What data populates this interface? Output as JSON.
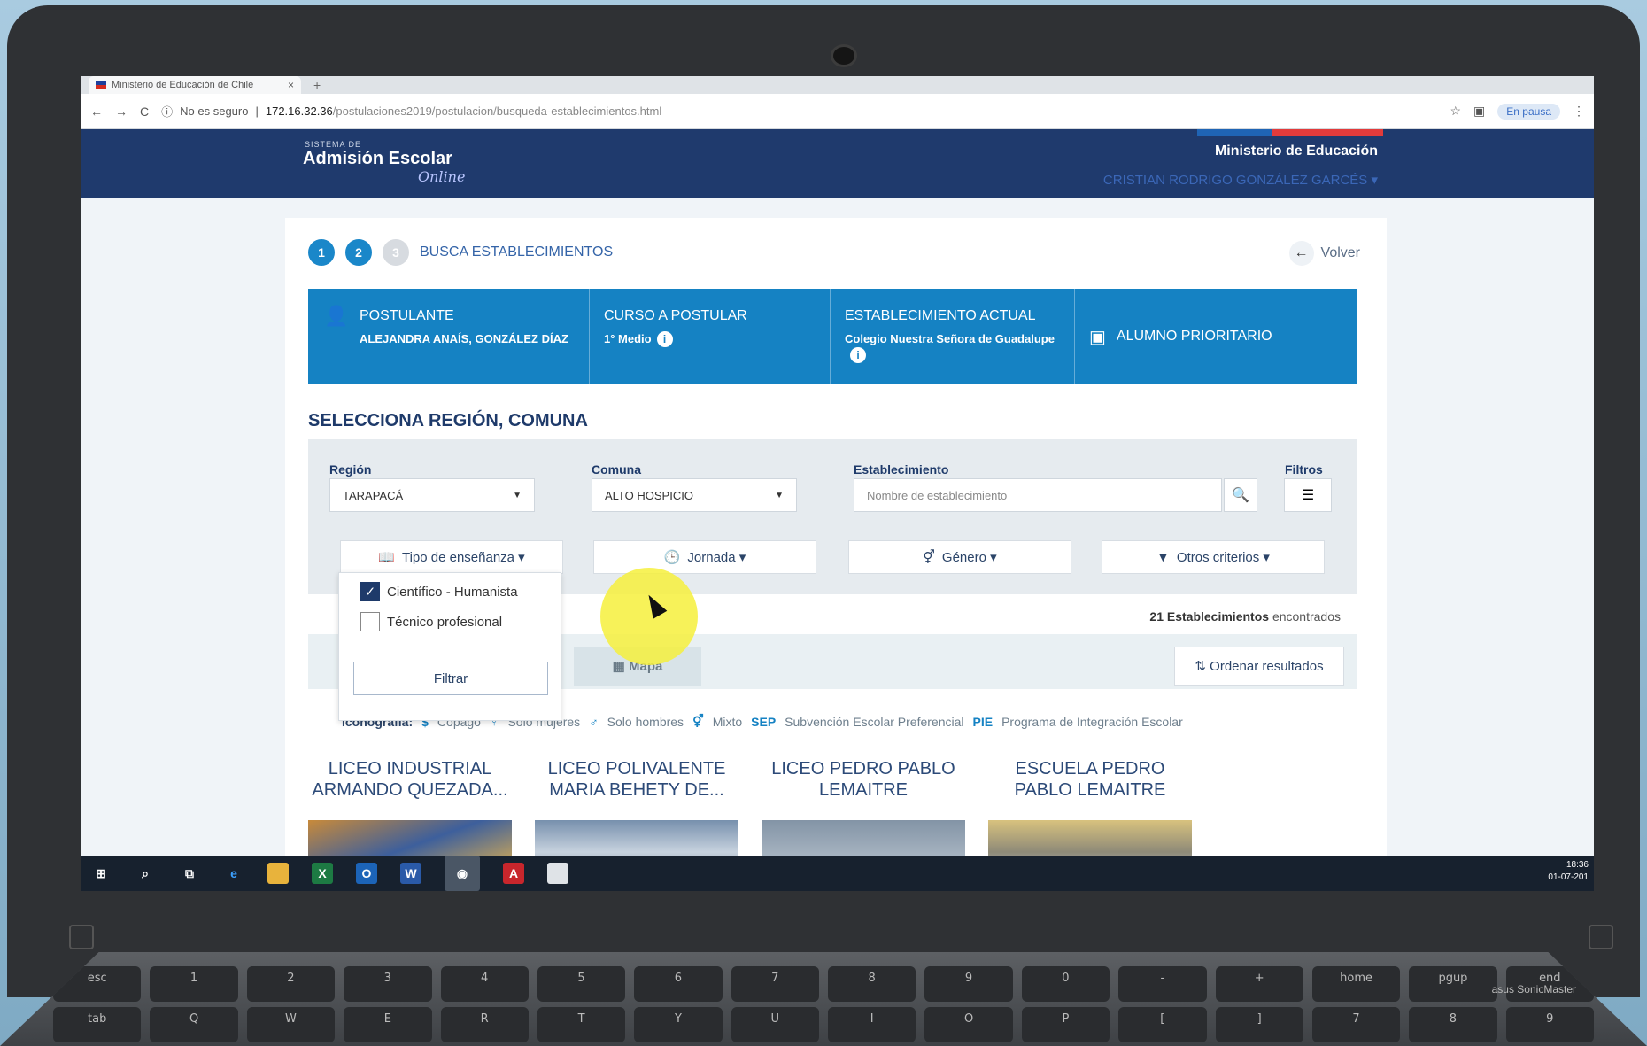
{
  "browser": {
    "tab_title": "Ministerio de Educación de Chile",
    "tab_close": "×",
    "new_tab": "+",
    "security": "No es seguro",
    "url_host": "172.16.32.36",
    "url_path": "/postulaciones2019/postulacion/busqueda-establecimientos.html",
    "paused_label": "En pausa",
    "back": "←",
    "forward": "→",
    "reload": "C",
    "star": "☆",
    "menu": "⋮"
  },
  "header": {
    "logo_small": "SISTEMA DE",
    "logo": "Admisión Escolar",
    "logo_online": "Online",
    "ministry": "Ministerio de Educación",
    "user": "CRISTIAN RODRIGO GONZÁLEZ GARCÉS ▾"
  },
  "steps": {
    "one": "1",
    "two": "2",
    "three": "3",
    "label": "BUSCA ESTABLECIMIENTOS",
    "back_label": "Volver"
  },
  "info": {
    "postulante_label": "POSTULANTE",
    "postulante_value": "ALEJANDRA ANAÍS, GONZÁLEZ DÍAZ",
    "curso_label": "CURSO A POSTULAR",
    "curso_value": "1° Medio",
    "establecimiento_label": "ESTABLECIMIENTO ACTUAL",
    "establecimiento_value": "Colegio Nuestra Señora de Guadalupe",
    "prioritario_label": "ALUMNO PRIORITARIO"
  },
  "section_title": "SELECCIONA REGIÓN, COMUNA",
  "filters": {
    "region_label": "Región",
    "region_value": "TARAPACÁ",
    "comuna_label": "Comuna",
    "comuna_value": "ALTO HOSPICIO",
    "establecimiento_label": "Establecimiento",
    "establecimiento_placeholder": "Nombre de establecimiento",
    "filtros_label": "Filtros",
    "tipo": "Tipo de enseñanza ▾",
    "jornada": "Jornada ▾",
    "genero": "Género ▾",
    "otros": "Otros criterios ▾"
  },
  "dropdown": {
    "option1": "Científico - Humanista",
    "option2": "Técnico profesional",
    "button": "Filtrar"
  },
  "results": {
    "count_bold": "21 Establecimientos",
    "count_rest": "encontrados",
    "mapa": "Mapa",
    "ordenar": "Ordenar resultados"
  },
  "legend": {
    "title": "Iconografía:",
    "copago_icon": "$",
    "copago": "Copago",
    "mujeres": "Solo mujeres",
    "hombres": "Solo hombres",
    "mixto": "Mixto",
    "sep_abbr": "SEP",
    "sep": "Subvención Escolar Preferencial",
    "pie_abbr": "PIE",
    "pie": "Programa de Integración Escolar"
  },
  "schools": [
    {
      "name": "LICEO INDUSTRIAL ARMANDO QUEZADA..."
    },
    {
      "name": "LICEO POLIVALENTE MARIA BEHETY DE..."
    },
    {
      "name": "LICEO PEDRO PABLO LEMAITRE"
    },
    {
      "name": "ESCUELA PEDRO PABLO LEMAITRE"
    }
  ],
  "taskbar": {
    "time": "18:36",
    "date": "01-07-201"
  },
  "laptop": {
    "brand": "asus SonicMaster"
  },
  "colors": {
    "header_bg": "#1f3a6d",
    "info_bg": "#1582c3",
    "accent": "#1e3a6a"
  }
}
